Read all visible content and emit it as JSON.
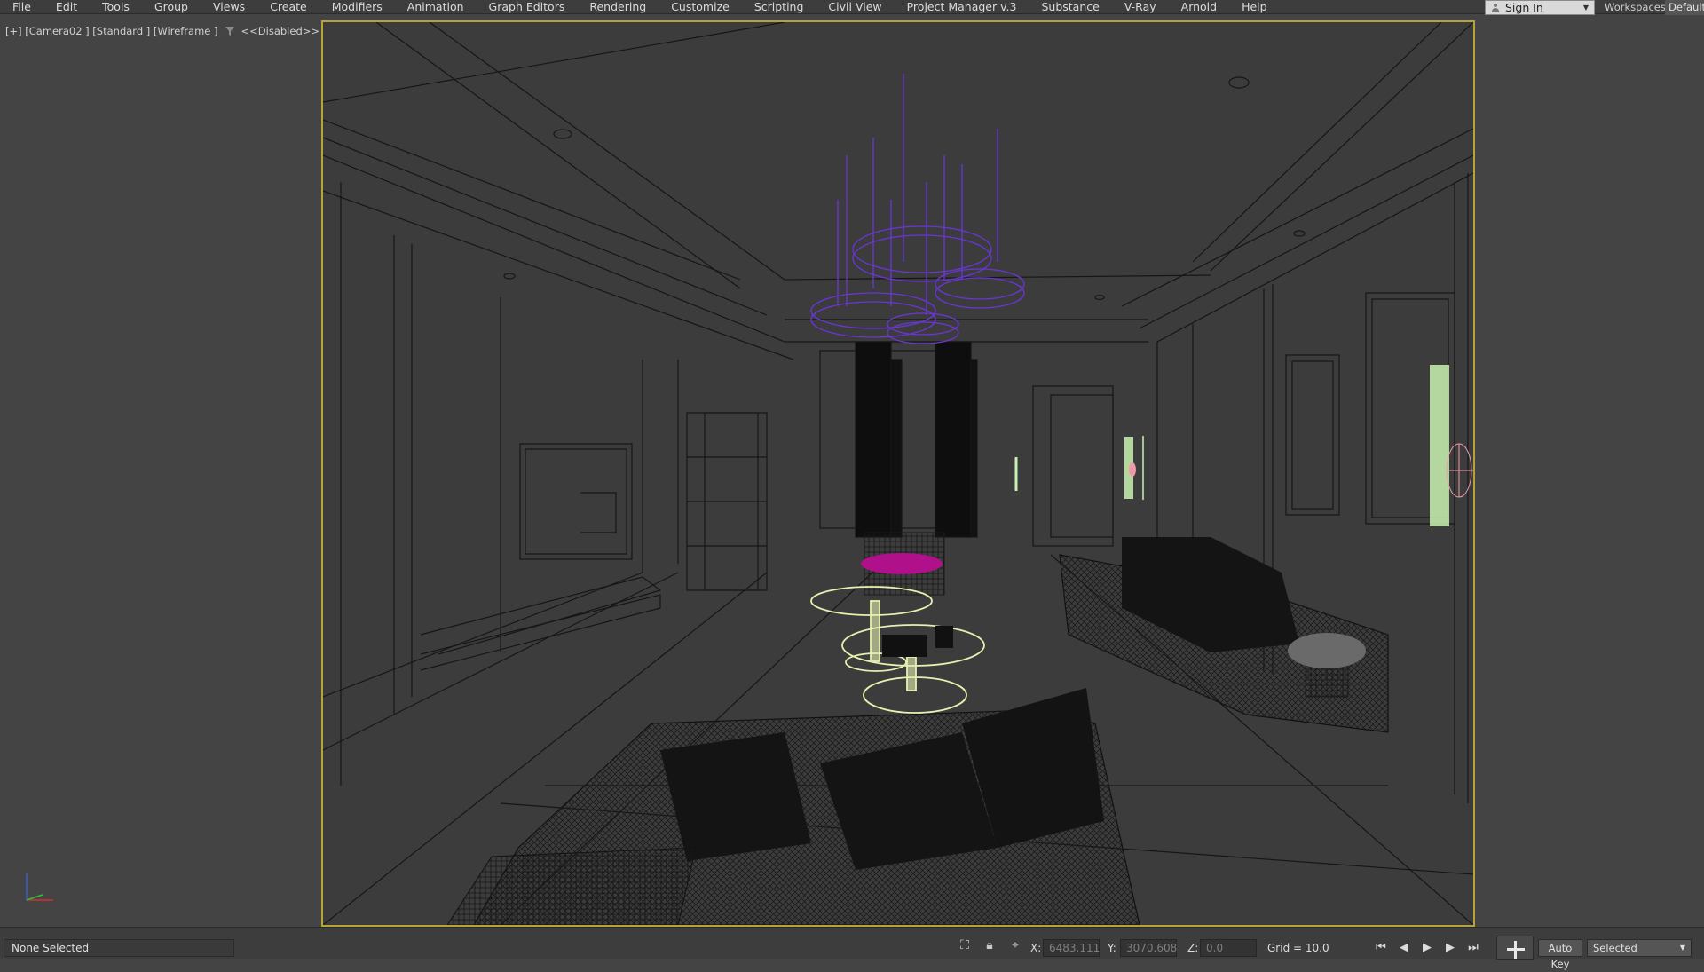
{
  "menubar": {
    "items": [
      "File",
      "Edit",
      "Tools",
      "Group",
      "Views",
      "Create",
      "Modifiers",
      "Animation",
      "Graph Editors",
      "Rendering",
      "Customize",
      "Scripting",
      "Civil View",
      "Project Manager v.3",
      "Substance",
      "V-Ray",
      "Arnold",
      "Help"
    ],
    "sign_in": "Sign In",
    "workspaces_label": "Workspaces:",
    "workspaces_value": "Default"
  },
  "viewport": {
    "label": "[+] [Camera02 ] [Standard ] [Wireframe ]",
    "filter_label": "<<Disabled>>"
  },
  "statusbar": {
    "selection": "None Selected",
    "x_label": "X:",
    "x_value": "6483.111",
    "y_label": "Y:",
    "y_value": "3070.608",
    "z_label": "Z:",
    "z_value": "0.0",
    "grid": "Grid = 10.0",
    "auto_key": "Auto Key",
    "key_filter": "Selected"
  },
  "colors": {
    "viewport_border": "#b8a23a",
    "chandelier": "#6b35d8",
    "table_glass": "#e6f0b0",
    "sconce": "#c8f2b0",
    "stool_cushion": "#b0108a"
  }
}
